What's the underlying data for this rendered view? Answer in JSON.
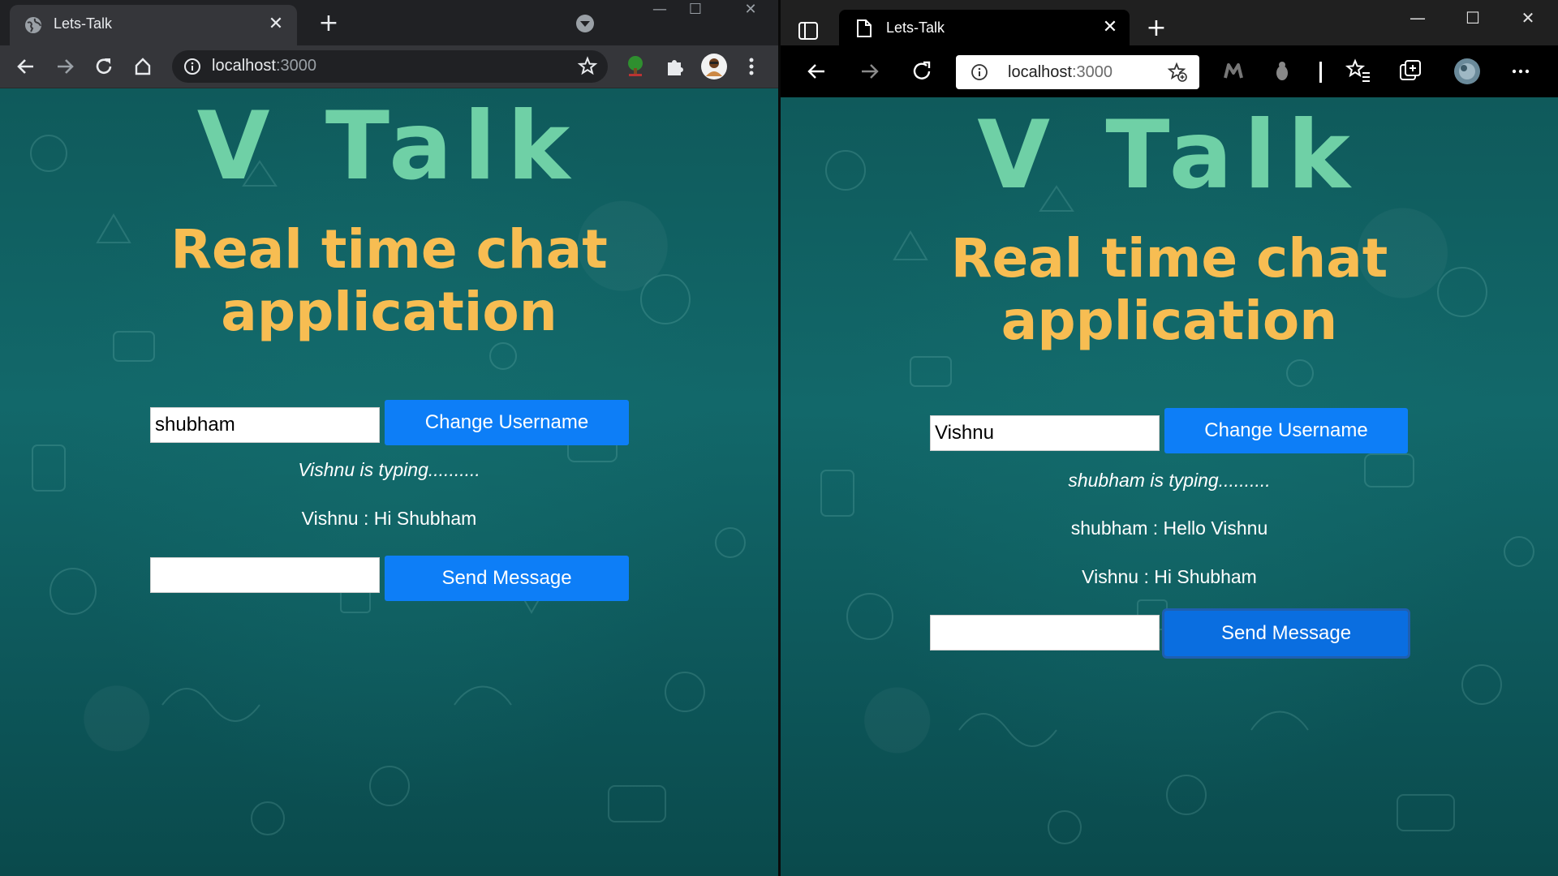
{
  "left_window": {
    "tab_title": "Lets-Talk",
    "url_host": "localhost",
    "url_port": ":3000",
    "brand": "V Talk",
    "subtitle": "Real time chat application",
    "username_value": "shubham",
    "change_username_label": "Change Username",
    "typing_status": "Vishnu is typing..........",
    "messages": [
      "Vishnu : Hi Shubham"
    ],
    "message_input_value": "",
    "send_label": "Send Message",
    "icons": [
      "globe-icon",
      "close-icon",
      "new-tab-icon",
      "tab-search-icon",
      "minimize-icon",
      "maximize-icon",
      "window-close-icon",
      "back-icon",
      "forward-icon",
      "reload-icon",
      "home-icon",
      "info-icon",
      "bookmark-star-icon",
      "tree-extension-icon",
      "puzzle-extension-icon",
      "avatar",
      "kebab-menu-icon"
    ]
  },
  "right_window": {
    "tab_title": "Lets-Talk",
    "url_host": "localhost",
    "url_port": ":3000",
    "brand": "V Talk",
    "subtitle": "Real time chat application",
    "username_value": "Vishnu",
    "change_username_label": "Change Username",
    "typing_status": "shubham is typing..........",
    "messages": [
      "shubham : Hello Vishnu",
      "Vishnu : Hi Shubham"
    ],
    "message_input_value": "",
    "send_label": "Send Message",
    "icons": [
      "tab-actions-icon",
      "page-icon",
      "close-icon",
      "new-tab-icon",
      "minimize-icon",
      "maximize-icon",
      "window-close-icon",
      "back-icon",
      "forward-icon",
      "reload-icon",
      "info-icon",
      "add-favorite-icon",
      "extension-icon",
      "bug-extension-icon",
      "favorites-icon",
      "collections-icon",
      "avatar",
      "more-icon"
    ]
  },
  "colors": {
    "brand": "#6fd0a6",
    "subtitle": "#f7bd52",
    "button": "#0d7ef7",
    "background": "#0f5a5b"
  }
}
